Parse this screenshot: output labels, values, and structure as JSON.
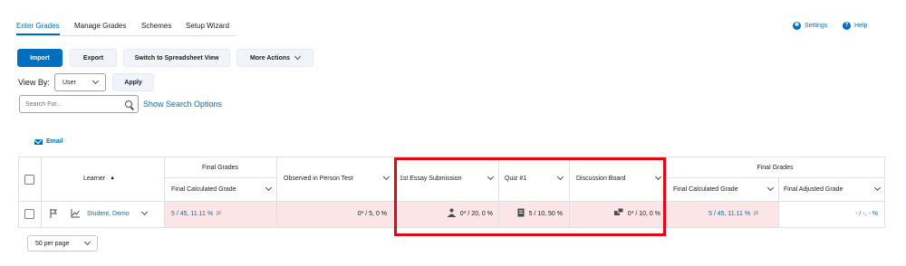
{
  "nav": {
    "tabs": [
      "Enter Grades",
      "Manage Grades",
      "Schemes",
      "Setup Wizard"
    ],
    "settings": "Settings",
    "help": "Help"
  },
  "toolbar": {
    "import": "Import",
    "export": "Export",
    "spreadsheet": "Switch to Spreadsheet View",
    "more_actions": "More Actions"
  },
  "view": {
    "label": "View By:",
    "selected": "User",
    "apply": "Apply"
  },
  "search": {
    "placeholder": "Search For...",
    "options_link": "Show Search Options"
  },
  "email": "Email",
  "table": {
    "group_final_grades_left": "Final Grades",
    "group_final_grades_right": "Final Grades",
    "learner_header": "Learner",
    "final_calculated_grade": "Final Calculated Grade",
    "observed": "Observed in Person Test",
    "essay": "1st Essay Submission",
    "quiz": "Quiz #1",
    "discussion": "Discussion Board",
    "final_calculated_grade_2": "Final Calculated Grade",
    "final_adjusted_grade": "Final Adjusted Grade",
    "row": {
      "student": "Student, Demo",
      "final_calc": "5 / 45, 11.11 %",
      "final_calc_suffix": "pl",
      "observed": "0* / 5, 0 %",
      "essay": "0* / 20, 0 %",
      "quiz": "5 / 10, 50 %",
      "discussion": "0* / 10, 0 %",
      "final_calc_2": "5 / 45, 11.11 %",
      "final_calc_2_suffix": "pl",
      "final_adjusted": "- / -, - %"
    }
  },
  "pagination": {
    "per_page": "50 per page"
  },
  "colors": {
    "accent": "#006fbf",
    "highlight_box": "#e30613",
    "row_highlight": "#fbe5e6"
  }
}
